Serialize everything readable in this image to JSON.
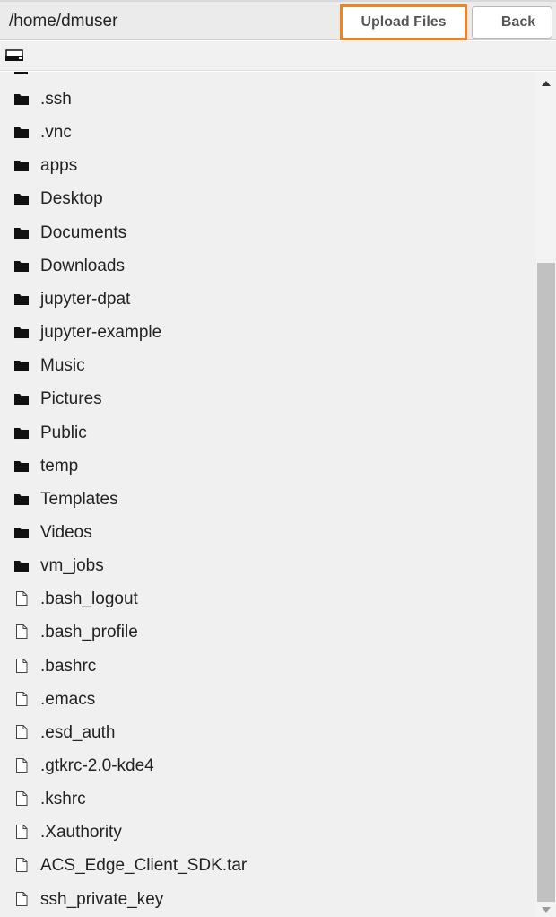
{
  "header": {
    "path": "/home/dmuser",
    "upload_label": "Upload Files",
    "back_label": "Back",
    "accent_color": "#f5821f"
  },
  "drive": {
    "icon": "drive-icon"
  },
  "items": [
    {
      "name": ".ssh",
      "type": "folder"
    },
    {
      "name": ".vnc",
      "type": "folder"
    },
    {
      "name": "apps",
      "type": "folder"
    },
    {
      "name": "Desktop",
      "type": "folder"
    },
    {
      "name": "Documents",
      "type": "folder"
    },
    {
      "name": "Downloads",
      "type": "folder"
    },
    {
      "name": "jupyter-dpat",
      "type": "folder"
    },
    {
      "name": "jupyter-example",
      "type": "folder"
    },
    {
      "name": "Music",
      "type": "folder"
    },
    {
      "name": "Pictures",
      "type": "folder"
    },
    {
      "name": "Public",
      "type": "folder"
    },
    {
      "name": "temp",
      "type": "folder"
    },
    {
      "name": "Templates",
      "type": "folder"
    },
    {
      "name": "Videos",
      "type": "folder"
    },
    {
      "name": "vm_jobs",
      "type": "folder"
    },
    {
      "name": ".bash_logout",
      "type": "file"
    },
    {
      "name": ".bash_profile",
      "type": "file"
    },
    {
      "name": ".bashrc",
      "type": "file"
    },
    {
      "name": ".emacs",
      "type": "file"
    },
    {
      "name": ".esd_auth",
      "type": "file"
    },
    {
      "name": ".gtkrc-2.0-kde4",
      "type": "file"
    },
    {
      "name": ".kshrc",
      "type": "file"
    },
    {
      "name": ".Xauthority",
      "type": "file"
    },
    {
      "name": "ACS_Edge_Client_SDK.tar",
      "type": "file"
    },
    {
      "name": "ssh_private_key",
      "type": "file"
    }
  ]
}
